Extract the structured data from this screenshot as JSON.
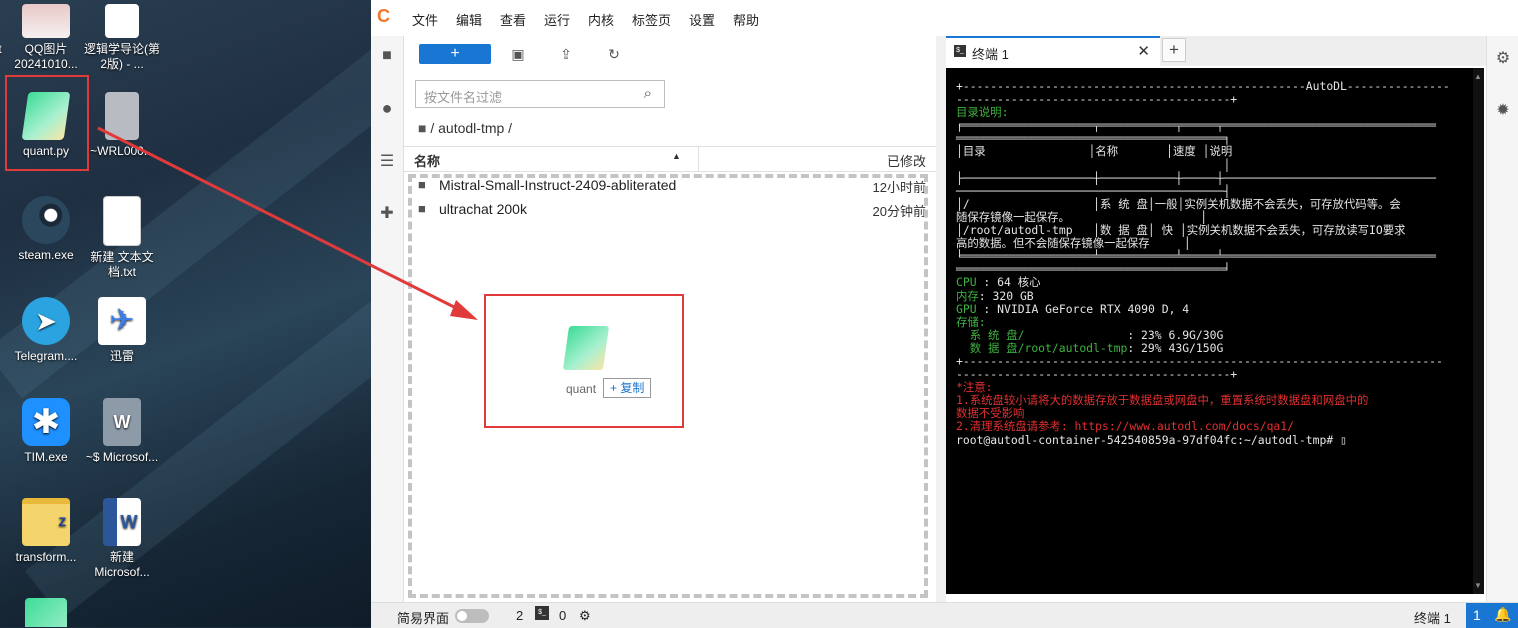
{
  "desktop": {
    "icons": [
      {
        "label": "t",
        "name": "icon-partial-left-1"
      },
      {
        "label": "QQ图片20241010...",
        "name": "icon-qq-image"
      },
      {
        "label": "逻辑学导论(第2版) - ...",
        "name": "icon-logic-book"
      },
      {
        "label": "quant.py",
        "name": "icon-quant-py"
      },
      {
        "label": "~WRL000...",
        "name": "icon-wrl-file"
      },
      {
        "label": "steam.exe",
        "name": "icon-steam"
      },
      {
        "label": "新建 文本文档.txt",
        "name": "icon-new-text"
      },
      {
        "label": "Telegram....",
        "name": "icon-telegram"
      },
      {
        "label": "迅雷",
        "name": "icon-xunlei"
      },
      {
        "label": "TIM.exe",
        "name": "icon-tim"
      },
      {
        "label": "~$ Microsof...",
        "name": "icon-word-temp"
      },
      {
        "label": "transform...",
        "name": "icon-transform"
      },
      {
        "label": "新建 Microsof...",
        "name": "icon-new-word"
      }
    ]
  },
  "menubar": {
    "items": [
      "文件",
      "编辑",
      "查看",
      "运行",
      "内核",
      "标签页",
      "设置",
      "帮助"
    ]
  },
  "filebrowser": {
    "filter_placeholder": "按文件名过滤",
    "breadcrumb": "/ autodl-tmp /",
    "col_name": "名称",
    "col_modified": "已修改",
    "files": [
      {
        "name": "Mistral-Small-Instruct-2409-abliterated",
        "modified": "12小时前"
      },
      {
        "name": "ultrachat 200k",
        "modified": "20分钟前"
      }
    ],
    "drag": {
      "file": "quant",
      "action": "+ 复制"
    }
  },
  "terminal": {
    "tab_label": "终端 1",
    "lines": [
      {
        "t": "+--------------------------------------------------AutoDL---------------",
        "c": "tw"
      },
      {
        "t": "----------------------------------------+",
        "c": "tw"
      },
      {
        "t": "目录说明:",
        "c": "tg"
      },
      {
        "t": "╒═══════════════════╤═══════════╤═════╤═══════════════════════════════",
        "c": "tw"
      },
      {
        "t": "═══════════════════════════════════════╕",
        "c": "tw"
      },
      {
        "t": "│目录               │名称       │速度 │说明",
        "c": "tw"
      },
      {
        "t": "                                       │",
        "c": "tw"
      },
      {
        "t": "├───────────────────┼───────────┼─────┼───────────────────────────────",
        "c": "tw"
      },
      {
        "t": "───────────────────────────────────────┤",
        "c": "tw"
      },
      {
        "t": "│/                  │系 统 盘│一般│实例关机数据不会丢失，可存放代码等。会",
        "c": "tw"
      },
      {
        "t": "随保存镜像一起保存。                   │",
        "c": "tw"
      },
      {
        "t": "│/root/autodl-tmp   │数 据 盘│ 快 │实例关机数据不会丢失，可存放读写IO要求",
        "c": "tw"
      },
      {
        "t": "高的数据。但不会随保存镜像一起保存     │",
        "c": "tw"
      },
      {
        "t": "╘═══════════════════╧═══════════╧═════╧═══════════════════════════════",
        "c": "tw"
      },
      {
        "t": "═══════════════════════════════════════╛",
        "c": "tw"
      },
      {
        "t": "CPU : 64 核心",
        "c": "mix",
        "k": "CPU",
        "v": " : 64 核心"
      },
      {
        "t": "内存: 320 GB",
        "c": "mix",
        "k": "内存",
        "v": ": 320 GB"
      },
      {
        "t": "GPU : NVIDIA GeForce RTX 4090 D, 4",
        "c": "mix",
        "k": "GPU",
        "v": " : NVIDIA GeForce RTX 4090 D, 4"
      },
      {
        "t": "存储:",
        "c": "tg"
      },
      {
        "t": "  系 统 盘/               : 23% 6.9G/30G",
        "c": "mix",
        "k": "  系 统 盘/              ",
        "v": " : 23% 6.9G/30G"
      },
      {
        "t": "  数 据 盘/root/autodl-tmp: 29% 43G/150G",
        "c": "mix",
        "k": "  数 据 盘/root/autodl-tmp",
        "v": ": 29% 43G/150G"
      },
      {
        "t": "+----------------------------------------------------------------------",
        "c": "tw"
      },
      {
        "t": "----------------------------------------+",
        "c": "tw"
      },
      {
        "t": "*注意:",
        "c": "tr"
      },
      {
        "t": "1.系统盘较小请将大的数据存放于数据盘或网盘中，重置系统时数据盘和网盘中的",
        "c": "tr"
      },
      {
        "t": "数据不受影响",
        "c": "tr"
      },
      {
        "t": "2.清理系统盘请参考: https://www.autodl.com/docs/qa1/",
        "c": "tr"
      },
      {
        "t": "root@autodl-container-542540859a-97df04fc:~/autodl-tmp# ▯",
        "c": "tw"
      }
    ]
  },
  "status": {
    "simple_mode": "简易界面",
    "count1": "2",
    "count2": "0",
    "terminal_label": "终端 1",
    "notifications": "1"
  },
  "colors": {
    "accent": "#1976d2",
    "jupyter_orange": "#f37726",
    "highlight_red": "#e03a3a",
    "term_green": "#3fb23f",
    "term_red": "#e03030"
  }
}
